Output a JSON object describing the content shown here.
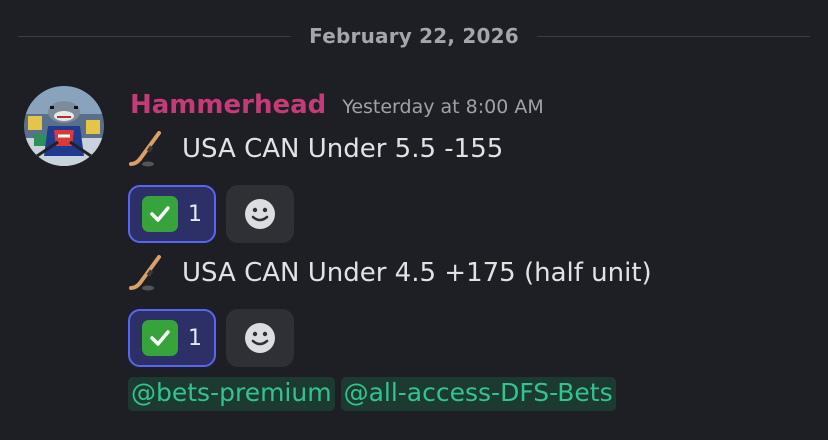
{
  "divider": {
    "date": "February 22, 2026"
  },
  "message": {
    "author": "Hammerhead",
    "timestamp": "Yesterday at 8:00 AM",
    "avatar_icon": "hockey-shark-avatar",
    "lines": [
      {
        "icon": "hockey-stick-icon",
        "text": "USA CAN Under 5.5 -155"
      },
      {
        "icon": "hockey-stick-icon",
        "text": "USA CAN Under 4.5 +175 (half unit)"
      }
    ],
    "reactions": [
      {
        "emoji": "check-mark-button-icon",
        "count": "1"
      },
      {
        "emoji": "check-mark-button-icon",
        "count": "1"
      }
    ],
    "mentions": [
      "@bets-premium",
      "@all-access-DFS-Bets"
    ]
  },
  "colors": {
    "background": "#1e1f24",
    "username": "#c43b77",
    "mention_text": "#32c48d",
    "mention_bg": "#1c3a31",
    "reaction_border": "#5865f2",
    "reaction_bg": "#2c3066"
  }
}
